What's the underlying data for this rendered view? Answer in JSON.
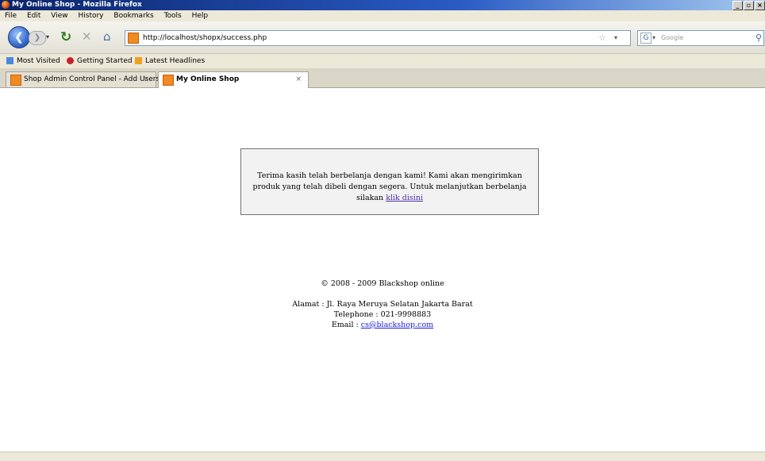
{
  "window": {
    "title": "My Online Shop - Mozilla Firefox",
    "buttons": [
      "_",
      "▫",
      "×"
    ]
  },
  "menu": [
    "File",
    "Edit",
    "View",
    "History",
    "Bookmarks",
    "Tools",
    "Help"
  ],
  "nav": {
    "url": "http://localhost/shopx/success.php",
    "search_placeholder": "Google",
    "search_engine_glyph": "G"
  },
  "bookmarks": [
    "Most Visited",
    "Getting Started",
    "Latest Headlines"
  ],
  "tabs": [
    {
      "label": "Shop Admin Control Panel - Add Users",
      "close": "×"
    },
    {
      "label": "My Online Shop",
      "close": "×"
    }
  ],
  "page": {
    "message": "Terima kasih telah berbelanja dengan kami! Kami akan mengirimkan produk yang telah dibeli dengan segera. Untuk melanjutkan berbelanja silakan",
    "link_text": "klik disini",
    "copyright": "© 2008 - 2009 Blackshop online",
    "address": "Alamat : Jl. Raya Meruya Selatan Jakarta Barat",
    "telephone": "Telephone : 021-9998883",
    "email_label": "Email :",
    "email": "cs@blackshop.com"
  },
  "colors": {
    "accent": "#0a246a",
    "link": "#1a1ae0",
    "visited_link": "#4b2ea8"
  }
}
